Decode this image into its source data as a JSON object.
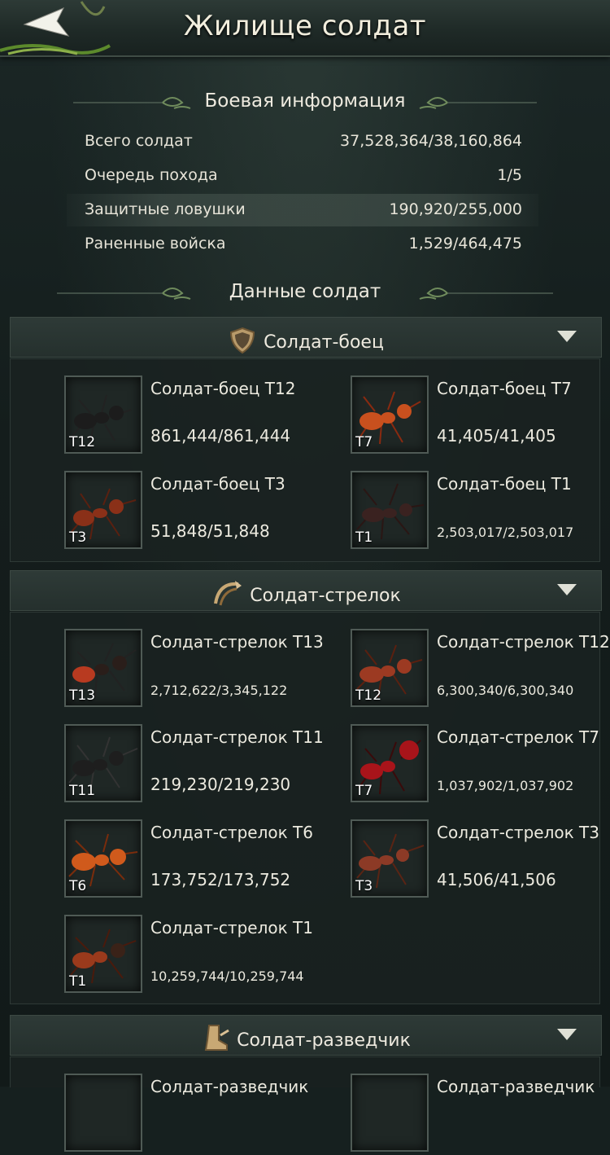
{
  "header": {
    "title": "Жилище солдат"
  },
  "battle": {
    "title": "Боевая информация",
    "rows": [
      {
        "label": "Всего солдат",
        "value": "37,528,364/38,160,864"
      },
      {
        "label": "Очередь похода",
        "value": "1/5"
      },
      {
        "label": "Защитные ловушки",
        "value": "190,920/255,000"
      },
      {
        "label": "Раненные войска",
        "value": "1,529/464,475"
      }
    ]
  },
  "soldiers": {
    "title": "Данные солдат",
    "categories": [
      {
        "label": "Солдат-боец",
        "units": [
          {
            "name": "Солдат-боец T12",
            "count": "861,444/861,444",
            "tier": "T12",
            "color": "#1c1c1c"
          },
          {
            "name": "Солдат-боец T7",
            "count": "41,405/41,405",
            "tier": "T7",
            "color": "#c8501e"
          },
          {
            "name": "Солдат-боец T3",
            "count": "51,848/51,848",
            "tier": "T3",
            "color": "#8a3018"
          },
          {
            "name": "Солдат-боец T1",
            "count": "2,503,017/2,503,017",
            "tier": "T1",
            "color": "#3a2220"
          }
        ]
      },
      {
        "label": "Солдат-стрелок",
        "units": [
          {
            "name": "Солдат-стрелок T13",
            "count": "2,712,622/3,345,122",
            "tier": "T13",
            "color": "#b83a20"
          },
          {
            "name": "Солдат-стрелок T12",
            "count": "6,300,340/6,300,340",
            "tier": "T12",
            "color": "#9c3a22"
          },
          {
            "name": "Солдат-стрелок T11",
            "count": "219,230/219,230",
            "tier": "T11",
            "color": "#1e1e1e"
          },
          {
            "name": "Солдат-стрелок T7",
            "count": "1,037,902/1,037,902",
            "tier": "T7",
            "color": "#a8141a"
          },
          {
            "name": "Солдат-стрелок T6",
            "count": "173,752/173,752",
            "tier": "T6",
            "color": "#d05a1c"
          },
          {
            "name": "Солдат-стрелок T3",
            "count": "41,506/41,506",
            "tier": "T3",
            "color": "#8c3a26"
          },
          {
            "name": "Солдат-стрелок T1",
            "count": "10,259,744/10,259,744",
            "tier": "T1",
            "color": "#9a3a1c"
          }
        ]
      },
      {
        "label": "Солдат-разведчик",
        "units": [
          {
            "name": "Солдат-разведчик"
          },
          {
            "name": "Солдат-разведчик"
          }
        ]
      }
    ]
  }
}
